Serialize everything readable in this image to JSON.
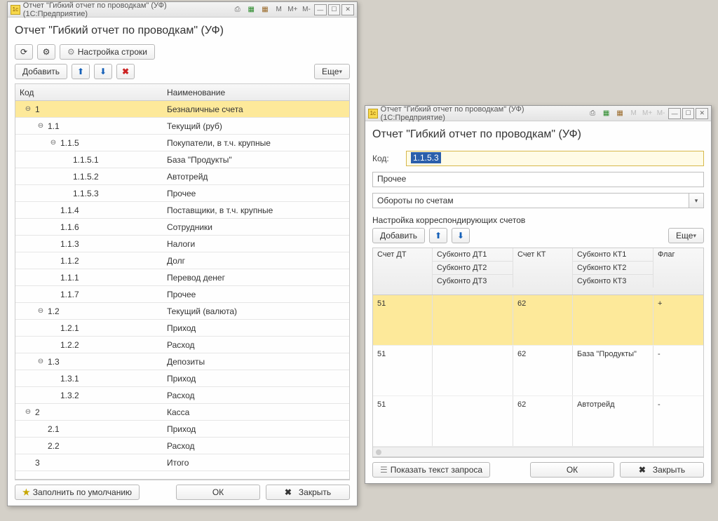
{
  "window1": {
    "titlebar": "Отчет \"Гибкий отчет по проводкам\" (УФ)  (1С:Предприятие)",
    "title": "Отчет \"Гибкий отчет по проводкам\" (УФ)",
    "settings_label": "Настройка строки",
    "add_label": "Добавить",
    "more_label": "Еще",
    "col_code": "Код",
    "col_name": "Наименование",
    "fill_default_label": "Заполнить по умолчанию",
    "ok_label": "ОК",
    "close_label": "Закрыть",
    "tree": [
      {
        "indent": 0,
        "toggle": "-",
        "code": "1",
        "name": "Безналичные счета",
        "selected": true
      },
      {
        "indent": 1,
        "toggle": "-",
        "code": "1.1",
        "name": "Текущий (руб)"
      },
      {
        "indent": 2,
        "toggle": "-",
        "code": "1.1.5",
        "name": "Покупатели, в т.ч. крупные"
      },
      {
        "indent": 3,
        "toggle": "",
        "code": "1.1.5.1",
        "name": "База \"Продукты\""
      },
      {
        "indent": 3,
        "toggle": "",
        "code": "1.1.5.2",
        "name": "Автотрейд"
      },
      {
        "indent": 3,
        "toggle": "",
        "code": "1.1.5.3",
        "name": "Прочее"
      },
      {
        "indent": 2,
        "toggle": "",
        "code": "1.1.4",
        "name": "Поставщики, в т.ч. крупные"
      },
      {
        "indent": 2,
        "toggle": "",
        "code": "1.1.6",
        "name": "Сотрудники"
      },
      {
        "indent": 2,
        "toggle": "",
        "code": "1.1.3",
        "name": "Налоги"
      },
      {
        "indent": 2,
        "toggle": "",
        "code": "1.1.2",
        "name": "Долг"
      },
      {
        "indent": 2,
        "toggle": "",
        "code": "1.1.1",
        "name": "Перевод денег"
      },
      {
        "indent": 2,
        "toggle": "",
        "code": "1.1.7",
        "name": "Прочее"
      },
      {
        "indent": 1,
        "toggle": "-",
        "code": "1.2",
        "name": "Текущий (валюта)"
      },
      {
        "indent": 2,
        "toggle": "",
        "code": "1.2.1",
        "name": "Приход"
      },
      {
        "indent": 2,
        "toggle": "",
        "code": "1.2.2",
        "name": "Расход"
      },
      {
        "indent": 1,
        "toggle": "-",
        "code": "1.3",
        "name": "Депозиты"
      },
      {
        "indent": 2,
        "toggle": "",
        "code": "1.3.1",
        "name": "Приход"
      },
      {
        "indent": 2,
        "toggle": "",
        "code": "1.3.2",
        "name": "Расход"
      },
      {
        "indent": 0,
        "toggle": "-",
        "code": "2",
        "name": "Касса"
      },
      {
        "indent": 1,
        "toggle": "",
        "code": "2.1",
        "name": "Приход"
      },
      {
        "indent": 1,
        "toggle": "",
        "code": "2.2",
        "name": "Расход"
      },
      {
        "indent": 0,
        "toggle": "",
        "code": "3",
        "name": "Итого"
      }
    ]
  },
  "window2": {
    "titlebar": "Отчет \"Гибкий отчет по проводкам\" (УФ)  (1С:Предприятие)",
    "title": "Отчет \"Гибкий отчет по проводкам\" (УФ)",
    "code_label": "Код:",
    "code_value": "1.1.5.3",
    "name_value": "Прочее",
    "select_value": "Обороты по счетам",
    "section_label": "Настройка корреспондирующих счетов",
    "add_label": "Добавить",
    "more_label": "Еще",
    "headers": {
      "dt": "Счет ДТ",
      "sub1": "Субконто ДТ1",
      "sub2": "Субконто ДТ2",
      "sub3": "Субконто ДТ3",
      "kt": "Счет КТ",
      "subk1": "Субконто КТ1",
      "subk2": "Субконто КТ2",
      "subk3": "Субконто КТ3",
      "flag": "Флаг"
    },
    "rows": [
      {
        "dt": "51",
        "sub": "",
        "kt": "62",
        "subk": "",
        "flag": "+",
        "selected": true
      },
      {
        "dt": "51",
        "sub": "",
        "kt": "62",
        "subk": "База \"Продукты\"",
        "flag": "-"
      },
      {
        "dt": "51",
        "sub": "",
        "kt": "62",
        "subk": "Автотрейд",
        "flag": "-"
      }
    ],
    "show_query_label": "Показать текст запроса",
    "ok_label": "ОК",
    "close_label": "Закрыть"
  }
}
